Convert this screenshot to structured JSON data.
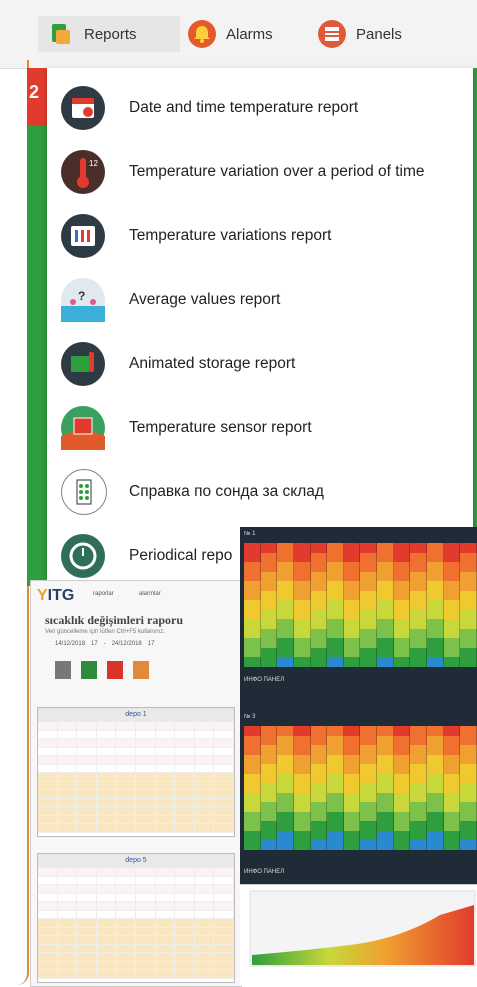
{
  "tabs": [
    {
      "label": "Reports",
      "icon": "reports-icon",
      "color": "#2e9e3e"
    },
    {
      "label": "Alarms",
      "icon": "alarm-bell-icon",
      "color": "#e55a2b"
    },
    {
      "label": "Panels",
      "icon": "panels-icon",
      "color": "#e05a3a"
    }
  ],
  "menu": {
    "items": [
      {
        "label": "Date and time temperature report",
        "icon": "calendar-clock-icon"
      },
      {
        "label": "Temperature variation over a period of time",
        "icon": "thermometer-clock-icon"
      },
      {
        "label": "Temperature variations report",
        "icon": "temperature-variations-icon"
      },
      {
        "label": "Average values report",
        "icon": "average-values-icon"
      },
      {
        "label": "Animated storage report",
        "icon": "animated-storage-icon"
      },
      {
        "label": "Temperature sensor report",
        "icon": "temperature-sensor-icon"
      },
      {
        "label": "Справка по сонда за склад",
        "icon": "warehouse-probe-icon"
      },
      {
        "label": "Periodical repo",
        "icon": "periodical-report-icon"
      }
    ]
  },
  "side_badge": "2",
  "dashboard": {
    "logo": "ITG",
    "nav": [
      "raporlar",
      "alarmlar"
    ],
    "title": "sıcaklık değişimleri raporu",
    "subtitle": "Veri güncelleme için lütfen Ctrl+F5 kullanınız.",
    "date_from": "14/12/2018",
    "date_to": "24/12/2018",
    "hour_from": "17",
    "hour_to": "17",
    "grids": [
      "depo 1",
      "depo 5"
    ]
  },
  "panels": {
    "panel1": "№ 1",
    "panel3": "№ 3",
    "info": "ИНФО ПАНЕЛ"
  },
  "colors": {
    "accent": "#e08a3a",
    "green": "#2e9e3e",
    "red": "#e23b2e",
    "dark": "#1f2b36"
  }
}
